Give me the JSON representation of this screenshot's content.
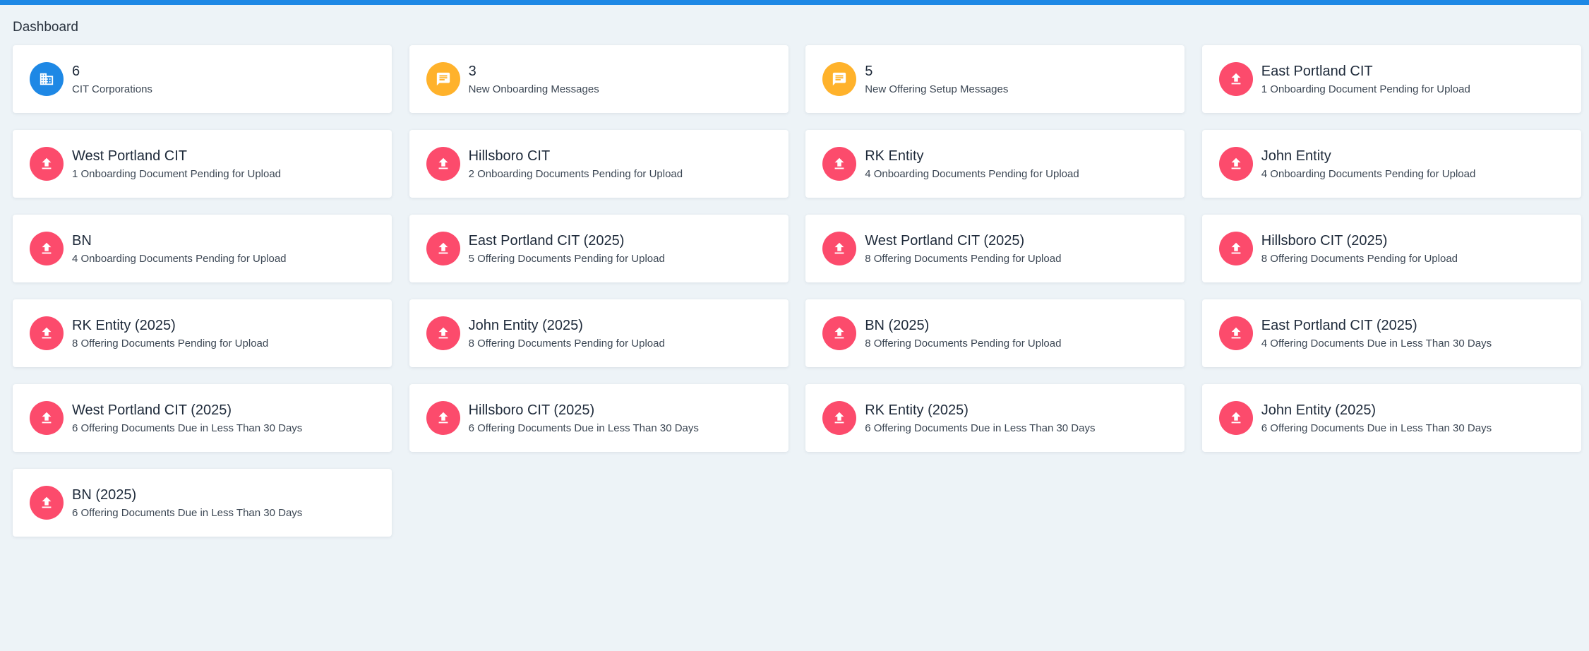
{
  "colors": {
    "topbar": "#1e88e5",
    "blue": "#1e88e5",
    "amber": "#ffb22b",
    "red": "#fc4b6c"
  },
  "page": {
    "title": "Dashboard"
  },
  "cards": [
    {
      "title": "6",
      "subtitle": "CIT Corporations",
      "icon": "building-icon",
      "color": "blue"
    },
    {
      "title": "3",
      "subtitle": "New Onboarding Messages",
      "icon": "message-icon",
      "color": "amber"
    },
    {
      "title": "5",
      "subtitle": "New Offering Setup Messages",
      "icon": "message-icon",
      "color": "amber"
    },
    {
      "title": "East Portland CIT",
      "subtitle": "1 Onboarding Document Pending for Upload",
      "icon": "upload-icon",
      "color": "red"
    },
    {
      "title": "West Portland CIT",
      "subtitle": "1 Onboarding Document Pending for Upload",
      "icon": "upload-icon",
      "color": "red"
    },
    {
      "title": "Hillsboro CIT",
      "subtitle": "2 Onboarding Documents Pending for Upload",
      "icon": "upload-icon",
      "color": "red"
    },
    {
      "title": "RK Entity",
      "subtitle": "4 Onboarding Documents Pending for Upload",
      "icon": "upload-icon",
      "color": "red"
    },
    {
      "title": "John Entity",
      "subtitle": "4 Onboarding Documents Pending for Upload",
      "icon": "upload-icon",
      "color": "red"
    },
    {
      "title": "BN",
      "subtitle": "4 Onboarding Documents Pending for Upload",
      "icon": "upload-icon",
      "color": "red"
    },
    {
      "title": "East Portland CIT (2025)",
      "subtitle": "5 Offering Documents Pending for Upload",
      "icon": "upload-icon",
      "color": "red"
    },
    {
      "title": "West Portland CIT (2025)",
      "subtitle": "8 Offering Documents Pending for Upload",
      "icon": "upload-icon",
      "color": "red"
    },
    {
      "title": "Hillsboro CIT (2025)",
      "subtitle": "8 Offering Documents Pending for Upload",
      "icon": "upload-icon",
      "color": "red"
    },
    {
      "title": "RK Entity (2025)",
      "subtitle": "8 Offering Documents Pending for Upload",
      "icon": "upload-icon",
      "color": "red"
    },
    {
      "title": "John Entity (2025)",
      "subtitle": "8 Offering Documents Pending for Upload",
      "icon": "upload-icon",
      "color": "red"
    },
    {
      "title": "BN (2025)",
      "subtitle": "8 Offering Documents Pending for Upload",
      "icon": "upload-icon",
      "color": "red"
    },
    {
      "title": "East Portland CIT (2025)",
      "subtitle": "4 Offering Documents Due in Less Than 30 Days",
      "icon": "upload-icon",
      "color": "red"
    },
    {
      "title": "West Portland CIT (2025)",
      "subtitle": "6 Offering Documents Due in Less Than 30 Days",
      "icon": "upload-icon",
      "color": "red"
    },
    {
      "title": "Hillsboro CIT (2025)",
      "subtitle": "6 Offering Documents Due in Less Than 30 Days",
      "icon": "upload-icon",
      "color": "red"
    },
    {
      "title": "RK Entity (2025)",
      "subtitle": "6 Offering Documents Due in Less Than 30 Days",
      "icon": "upload-icon",
      "color": "red"
    },
    {
      "title": "John Entity (2025)",
      "subtitle": "6 Offering Documents Due in Less Than 30 Days",
      "icon": "upload-icon",
      "color": "red"
    },
    {
      "title": "BN (2025)",
      "subtitle": "6 Offering Documents Due in Less Than 30 Days",
      "icon": "upload-icon",
      "color": "red"
    }
  ]
}
